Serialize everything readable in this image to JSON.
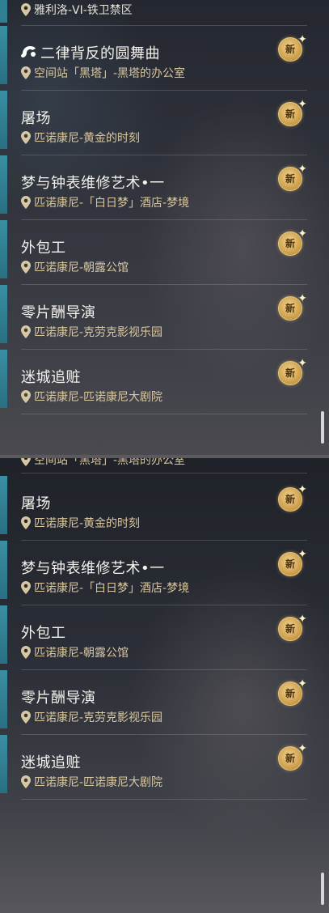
{
  "top_panel": {
    "partial_location": "雅利洛-VI-铁卫禁区",
    "items": [
      {
        "title": "二律背反的圆舞曲",
        "location": "空间站「黑塔」-黑塔的办公室",
        "badge": "新",
        "has_music_icon": true
      },
      {
        "title": "屠场",
        "location": "匹诺康尼-黄金的时刻",
        "badge": "新"
      },
      {
        "title": "梦与钟表维修艺术•一",
        "location": "匹诺康尼-「白日梦」酒店-梦境",
        "badge": "新"
      },
      {
        "title": "外包工",
        "location": "匹诺康尼-朝露公馆",
        "badge": "新"
      },
      {
        "title": "零片酬导演",
        "location": "匹诺康尼-克劳克影视乐园",
        "badge": "新"
      },
      {
        "title": "迷城追赃",
        "location": "匹诺康尼-匹诺康尼大剧院",
        "badge": "新"
      }
    ]
  },
  "bottom_panel": {
    "partial_location": "空间站「黑塔」-黑塔的办公室",
    "items": [
      {
        "title": "屠场",
        "location": "匹诺康尼-黄金的时刻",
        "badge": "新"
      },
      {
        "title": "梦与钟表维修艺术•一",
        "location": "匹诺康尼-「白日梦」酒店-梦境",
        "badge": "新"
      },
      {
        "title": "外包工",
        "location": "匹诺康尼-朝露公馆",
        "badge": "新"
      },
      {
        "title": "零片酬导演",
        "location": "匹诺康尼-克劳克影视乐园",
        "badge": "新"
      },
      {
        "title": "迷城追赃",
        "location": "匹诺康尼-匹诺康尼大剧院",
        "badge": "新"
      }
    ]
  },
  "icons": {
    "location": "map-pin-icon",
    "music": "music-note-icon",
    "new_badge": "new-badge-icon"
  }
}
